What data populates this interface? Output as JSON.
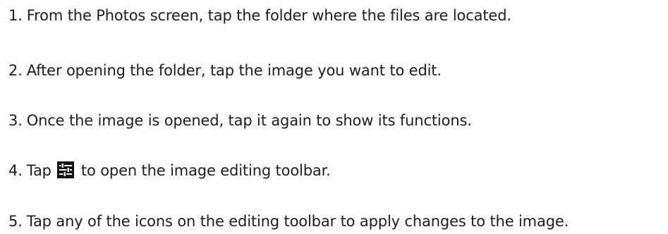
{
  "steps": [
    {
      "number": "1.",
      "text": "From the Photos screen, tap the folder where the files are located."
    },
    {
      "number": "2.",
      "text": "After opening the folder, tap the image you want to edit."
    },
    {
      "number": "3.",
      "text": "Once the image is opened, tap it again to show its functions."
    },
    {
      "number": "4.",
      "text_before": "Tap",
      "icon": "adjust-sliders-icon",
      "text_after": "to open the image editing toolbar."
    },
    {
      "number": "5.",
      "text": "Tap any of the icons on the editing toolbar to apply changes to the image."
    }
  ],
  "colors": {
    "text": "#1e1e1e",
    "icon_background": "#151515",
    "icon_foreground": "#ffffff"
  }
}
